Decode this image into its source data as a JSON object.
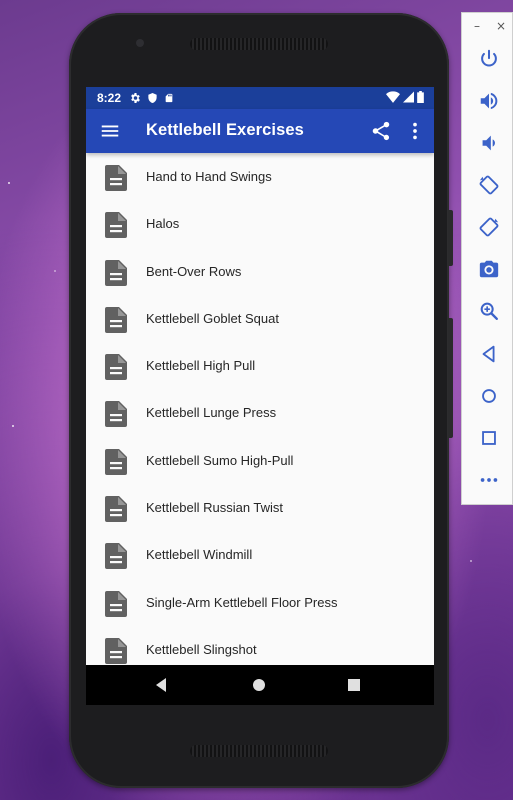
{
  "status_bar": {
    "time": "8:22"
  },
  "app_bar": {
    "title": "Kettlebell Exercises"
  },
  "exercises": [
    "Hand to Hand Swings",
    "Halos",
    "Bent-Over Rows",
    "Kettlebell Goblet Squat",
    "Kettlebell High Pull",
    "Kettlebell Lunge Press",
    "Kettlebell Sumo High-Pull",
    "Kettlebell Russian Twist",
    "Kettlebell Windmill",
    "Single-Arm Kettlebell Floor Press",
    "Kettlebell Slingshot"
  ],
  "emulator_toolbar": {
    "minimize": "–",
    "close": "×",
    "buttons": [
      "power-icon",
      "volume-up-icon",
      "volume-down-icon",
      "rotate-left-icon",
      "rotate-right-icon",
      "camera-icon",
      "zoom-icon",
      "back-icon",
      "home-icon",
      "overview-icon",
      "more-icon"
    ]
  },
  "colors": {
    "status_bar": "#1b3f9a",
    "app_bar": "#2548b6",
    "list_icon": "#616161",
    "toolbar_icon": "#3c63c9"
  }
}
